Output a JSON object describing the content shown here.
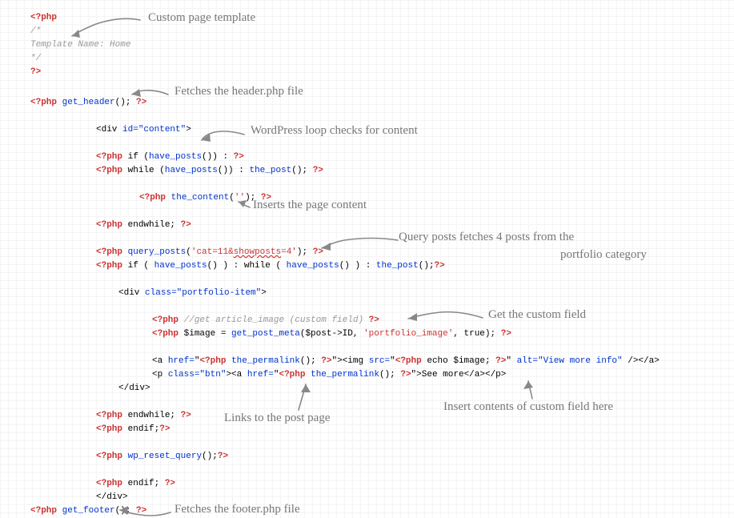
{
  "notes": {
    "n1": "Custom page template",
    "n2": "Fetches the header.php file",
    "n3": "WordPress loop checks for content",
    "n4": "Inserts the page content",
    "n5a": "Query posts fetches 4 posts from the",
    "n5b": "portfolio category",
    "n6": "Get the custom field",
    "n7": "Links to the post page",
    "n8": "Insert contents of custom field here",
    "n9": "Fetches the footer.php file"
  },
  "code": {
    "php_open": "<?php",
    "php_close": "?>",
    "cmt_open": "/*",
    "tpl_name": "Template Name: Home",
    "cmt_close": "*/",
    "get_header": "get_header",
    "div_open_a": "<div ",
    "id_attr": "id=",
    "content_id": "\"content\"",
    "div_open_b": ">",
    "if_kw": " if ",
    "have_posts": "have_posts",
    "colon": " : ",
    "while_kw": " while ",
    "the_post": "the_post",
    "the_content": "the_content",
    "endwhile": " endwhile; ",
    "query_posts": "query_posts",
    "qp_arg": "'cat=11&showposts=4'",
    "qp_arg_u": "showposts",
    "if2": " if ( ",
    "while2": "while ( ",
    "div_class_a": "<div ",
    "class_attr": "class=",
    "portfolio_cls": "\"portfolio-item\"",
    "cmt_field": "//get article_image (custom field) ",
    "img_assign": " $image = ",
    "get_post_meta": "get_post_meta",
    "post_id": "($post->ID, ",
    "pf_img": "'portfolio_image'",
    "true_arg": ", true); ",
    "a_open": "<a ",
    "href_attr": "href=",
    "the_permalink": "the_permalink",
    "img_tag_a": "><img ",
    "src_attr": "src=",
    "echo_img": " echo $image; ",
    "alt_attr": " alt=",
    "alt_val": "\"View more info\"",
    "img_close": " /></a>",
    "p_open": "<p ",
    "btn_cls": "\"btn\"",
    "see_more": ">See more</a></p>",
    "div_close": "</div>",
    "endif": " endif;",
    "wp_reset": "wp_reset_query",
    "endif2": " endif; ",
    "get_footer": "get_footer"
  }
}
